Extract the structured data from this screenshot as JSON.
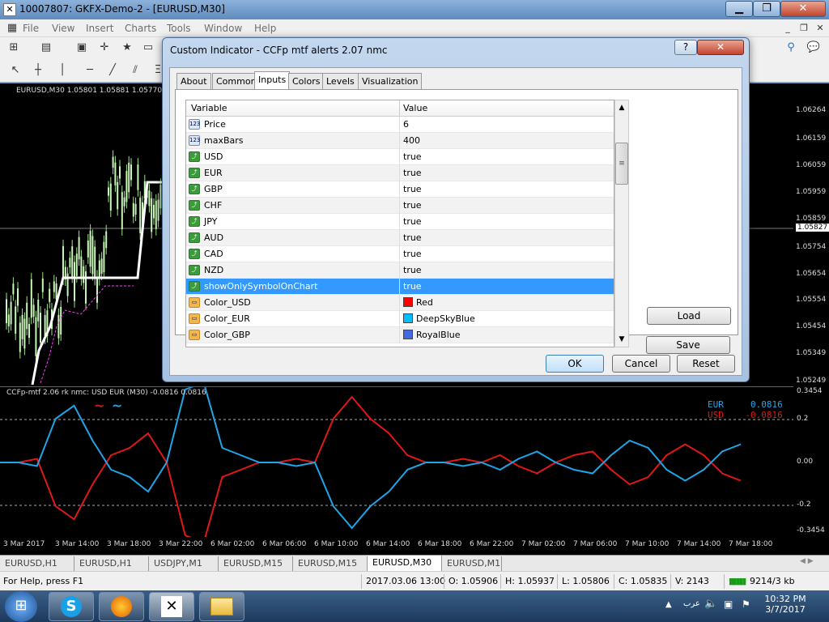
{
  "window": {
    "title": "10007807: GKFX-Demo-2 - [EURUSD,M30]"
  },
  "menu": [
    "File",
    "View",
    "Insert",
    "Charts",
    "Tools",
    "Window",
    "Help"
  ],
  "chart": {
    "header": "EURUSD,M30  1.05801 1.05881 1.05770 1.",
    "price_axis": [
      "1.06264",
      "1.06159",
      "1.06059",
      "1.05959",
      "1.05859",
      "1.05827",
      "1.05754",
      "1.05654",
      "1.05554",
      "1.05454",
      "1.05349",
      "1.05249"
    ],
    "indicator_label": "CCFp-mtf 2.06 rk nmc:  USD EUR (M30) -0.0816 0.0816",
    "indicator_axis": [
      "0.3454",
      "0.2",
      "0.00",
      "-0.2",
      "-0.3454"
    ],
    "time_axis": [
      "3 Mar 2017",
      "3 Mar 14:00",
      "3 Mar 18:00",
      "3 Mar 22:00",
      "6 Mar 02:00",
      "6 Mar 06:00",
      "6 Mar 10:00",
      "6 Mar 14:00",
      "6 Mar 18:00",
      "6 Mar 22:00",
      "7 Mar 02:00",
      "7 Mar 06:00",
      "7 Mar 10:00",
      "7 Mar 14:00",
      "7 Mar 18:00"
    ],
    "legend": [
      {
        "name": "EUR",
        "value": "0.0816",
        "color": "#1ea6ea"
      },
      {
        "name": "USD",
        "value": "-0.0816",
        "color": "#e01818"
      }
    ],
    "colors": {
      "usd": "#e01818",
      "eur": "#1ea6ea",
      "bull": "#b6f0a0"
    }
  },
  "dialog": {
    "title": "Custom Indicator - CCFp mtf alerts 2.07  nmc",
    "help": "?",
    "tabs": [
      "About",
      "Common",
      "Inputs",
      "Colors",
      "Levels",
      "Visualization"
    ],
    "active_tab": "Inputs",
    "columns": [
      "Variable",
      "Value"
    ],
    "rows": [
      {
        "icon": "123",
        "name": "Price",
        "value": "6"
      },
      {
        "icon": "123",
        "name": "maxBars",
        "value": "400"
      },
      {
        "icon": "bool",
        "name": "USD",
        "value": "true"
      },
      {
        "icon": "bool",
        "name": "EUR",
        "value": "true"
      },
      {
        "icon": "bool",
        "name": "GBP",
        "value": "true"
      },
      {
        "icon": "bool",
        "name": "CHF",
        "value": "true"
      },
      {
        "icon": "bool",
        "name": "JPY",
        "value": "true"
      },
      {
        "icon": "bool",
        "name": "AUD",
        "value": "true"
      },
      {
        "icon": "bool",
        "name": "CAD",
        "value": "true"
      },
      {
        "icon": "bool",
        "name": "NZD",
        "value": "true"
      },
      {
        "icon": "bool",
        "name": "showOnlySymbolOnChart",
        "value": "true"
      },
      {
        "icon": "color",
        "name": "Color_USD",
        "value": "Red",
        "swatch": "#ff0000"
      },
      {
        "icon": "color",
        "name": "Color_EUR",
        "value": "DeepSkyBlue",
        "swatch": "#00bfff"
      },
      {
        "icon": "color",
        "name": "Color_GBP",
        "value": "RoyalBlue",
        "swatch": "#4169e1"
      }
    ],
    "selected_row": 10,
    "buttons": {
      "load": "Load",
      "save": "Save",
      "ok": "OK",
      "cancel": "Cancel",
      "reset": "Reset"
    }
  },
  "symbol_tabs": [
    "EURUSD,H1",
    "EURUSD,H1",
    "USDJPY,M1",
    "EURUSD,M15",
    "EURUSD,M15",
    "EURUSD,M30",
    "EURUSD,M1"
  ],
  "active_symbol_tab": 5,
  "status": {
    "help": "For Help, press F1",
    "datetime": "2017.03.06 13:00",
    "open": "O: 1.05906",
    "high": "H: 1.05937",
    "low": "L: 1.05806",
    "close": "C: 1.05835",
    "volume": "V: 2143",
    "traffic": "9214/3 kb"
  },
  "taskbar": {
    "time": "10:32 PM",
    "date": "3/7/2017",
    "lang": "عرب"
  }
}
